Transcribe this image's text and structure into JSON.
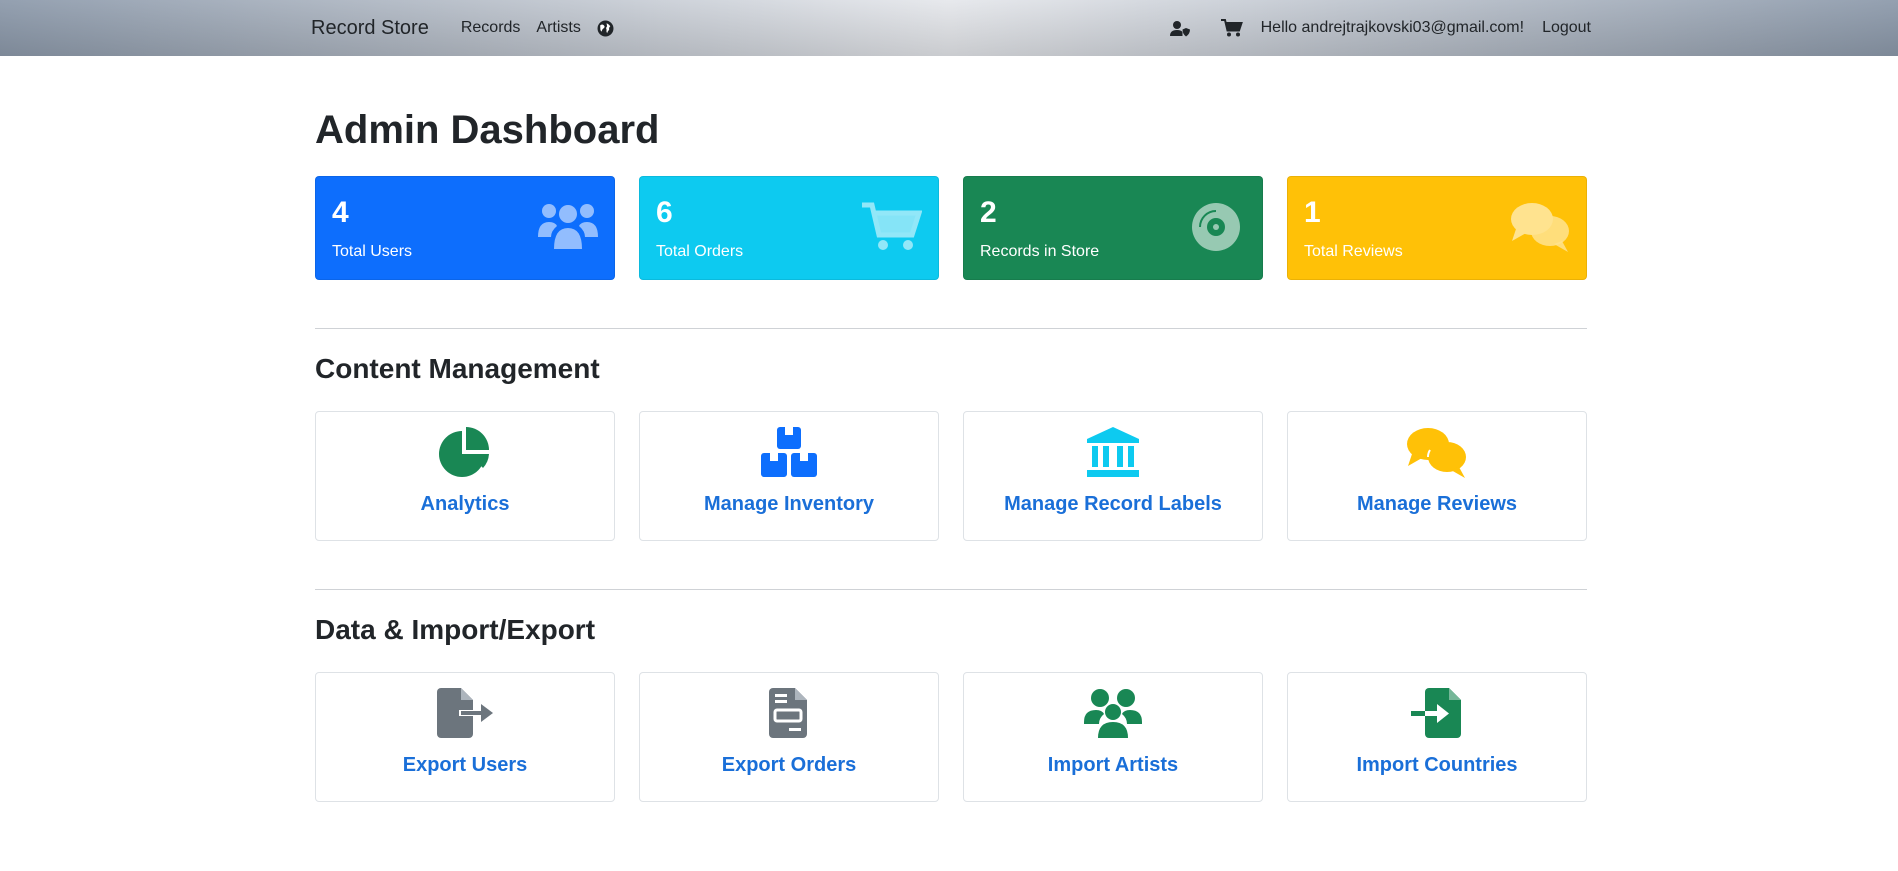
{
  "navbar": {
    "brand": "Record Store",
    "links": [
      "Records",
      "Artists"
    ],
    "globe_icon": "globe-icon",
    "user_settings_icon": "user-shield-icon",
    "cart_icon": "cart-icon",
    "greeting": "Hello andrejtrajkovski03@gmail.com!",
    "logout": "Logout"
  },
  "page": {
    "title": "Admin Dashboard"
  },
  "stats": [
    {
      "value": "4",
      "label": "Total Users",
      "color": "#0d6efd",
      "icon": "users-icon"
    },
    {
      "value": "6",
      "label": "Total Orders",
      "color": "#0dcaf0",
      "icon": "cart-icon"
    },
    {
      "value": "2",
      "label": "Records in Store",
      "color": "#198754",
      "icon": "record-disc-icon"
    },
    {
      "value": "1",
      "label": "Total Reviews",
      "color": "#ffc107",
      "icon": "comments-icon"
    }
  ],
  "content_management": {
    "title": "Content Management",
    "tiles": [
      {
        "label": "Analytics",
        "icon": "pie-chart-icon",
        "icon_color": "#198754"
      },
      {
        "label": "Manage Inventory",
        "icon": "boxes-icon",
        "icon_color": "#0d6efd"
      },
      {
        "label": "Manage Record Labels",
        "icon": "building-columns-icon",
        "icon_color": "#0dcaf0"
      },
      {
        "label": "Manage Reviews",
        "icon": "comments-icon",
        "icon_color": "#ffc107"
      }
    ]
  },
  "data_import_export": {
    "title": "Data & Import/Export",
    "tiles": [
      {
        "label": "Export Users",
        "icon": "file-export-icon",
        "icon_color": "#6c757d"
      },
      {
        "label": "Export Orders",
        "icon": "file-invoice-icon",
        "icon_color": "#6c757d"
      },
      {
        "label": "Import Artists",
        "icon": "users-icon",
        "icon_color": "#198754"
      },
      {
        "label": "Import Countries",
        "icon": "file-import-icon",
        "icon_color": "#198754"
      }
    ]
  },
  "colors": {
    "link": "#1a6fd8",
    "primary": "#0d6efd",
    "info": "#0dcaf0",
    "success": "#198754",
    "warning": "#ffc107",
    "secondary": "#6c757d"
  }
}
